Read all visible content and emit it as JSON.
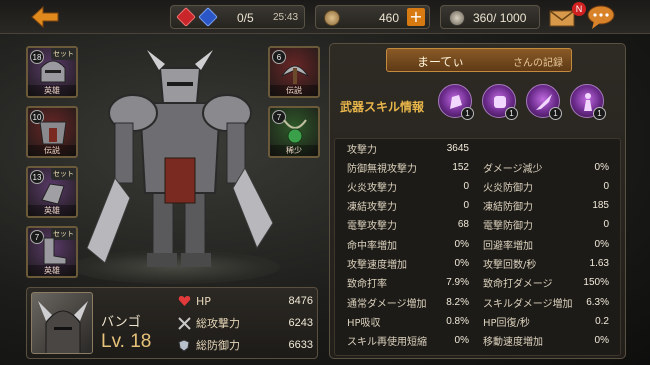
{
  "topbar": {
    "crystal_count": "0/5",
    "timer": "25:43",
    "coins": "460",
    "stamina": "360/ 1000",
    "mail_badge": "N"
  },
  "left_slots": [
    {
      "level": "18",
      "set": "セット",
      "grade": "英雄",
      "color": "#5a3a6a"
    },
    {
      "level": "10",
      "set": "",
      "grade": "伝説",
      "color": "#6a2626"
    },
    {
      "level": "13",
      "set": "セット",
      "grade": "英雄",
      "color": "#5a3a6a"
    },
    {
      "level": "7",
      "set": "セット",
      "grade": "英雄",
      "color": "#5a3a6a"
    }
  ],
  "right_slots": [
    {
      "level": "6",
      "grade": "伝説",
      "color": "#6a2626"
    },
    {
      "level": "7",
      "grade": "稀少",
      "color": "#2f5a2a"
    }
  ],
  "character": {
    "name": "バンゴ",
    "level": "Lv. 18",
    "stats": [
      {
        "label": "HP",
        "value": "8476",
        "icon": "heart-icon"
      },
      {
        "label": "総攻撃力",
        "value": "6243",
        "icon": "crossed-swords-icon"
      },
      {
        "label": "総防御力",
        "value": "6633",
        "icon": "shield-icon"
      }
    ]
  },
  "profile": {
    "name": "まーてぃ",
    "suffix": "さんの記録",
    "weapon_skill_title": "武器スキル情報",
    "weapon_skills": [
      {
        "count": "1",
        "icon": "skill-hand-icon"
      },
      {
        "count": "1",
        "icon": "skill-fist-icon"
      },
      {
        "count": "1",
        "icon": "skill-slash-icon"
      },
      {
        "count": "1",
        "icon": "skill-figure-icon"
      }
    ]
  },
  "stats": {
    "attack_label": "攻撃力",
    "attack_value": "3645",
    "rows": [
      {
        "l_label": "防御無視攻撃力",
        "l_value": "152",
        "r_label": "ダメージ減少",
        "r_value": "0%"
      },
      {
        "l_label": "火炎攻撃力",
        "l_value": "0",
        "r_label": "火炎防御力",
        "r_value": "0"
      },
      {
        "l_label": "凍結攻撃力",
        "l_value": "0",
        "r_label": "凍結防御力",
        "r_value": "185"
      },
      {
        "l_label": "電撃攻撃力",
        "l_value": "68",
        "r_label": "電撃防御力",
        "r_value": "0"
      },
      {
        "l_label": "命中率増加",
        "l_value": "0%",
        "r_label": "回避率増加",
        "r_value": "0%"
      },
      {
        "l_label": "攻撃速度増加",
        "l_value": "0%",
        "r_label": "攻撃回数/秒",
        "r_value": "1.63"
      },
      {
        "l_label": "致命打率",
        "l_value": "7.9%",
        "r_label": "致命打ダメージ",
        "r_value": "150%"
      },
      {
        "l_label": "通常ダメージ増加",
        "l_value": "8.2%",
        "r_label": "スキルダメージ増加",
        "r_value": "6.3%"
      },
      {
        "l_label": "HP吸収",
        "l_value": "0.8%",
        "r_label": "HP回復/秒",
        "r_value": "0.2"
      },
      {
        "l_label": "スキル再使用短縮",
        "l_value": "0%",
        "r_label": "移動速度増加",
        "r_value": "0%"
      }
    ]
  }
}
